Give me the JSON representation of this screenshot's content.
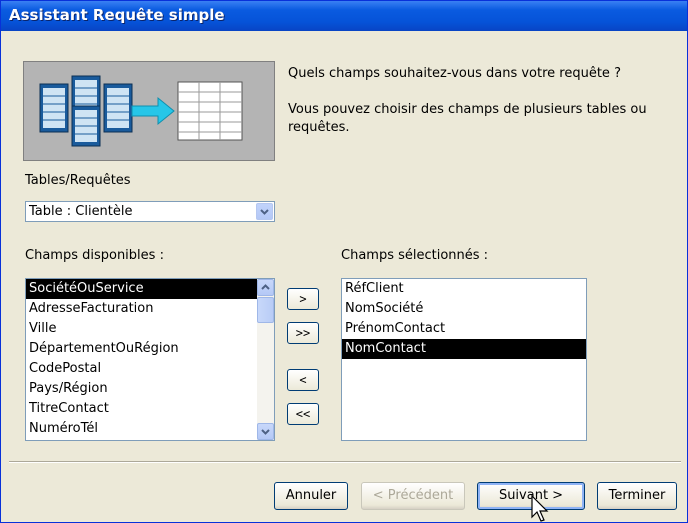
{
  "window": {
    "title": "Assistant Requête simple"
  },
  "prompt": {
    "line1": "Quels champs souhaitez-vous dans votre requête ?",
    "line2": "Vous pouvez choisir des champs de plusieurs tables ou requêtes."
  },
  "tables": {
    "label": "Tables/Requêtes",
    "selected": "Table : Clientèle"
  },
  "available": {
    "label": "Champs disponibles :",
    "items": [
      "SociétéOuService",
      "AdresseFacturation",
      "Ville",
      "DépartementOuRégion",
      "CodePostal",
      "Pays/Région",
      "TitreContact",
      "NuméroTél"
    ]
  },
  "selected": {
    "label": "Champs sélectionnés :",
    "items": [
      "RéfClient",
      "NomSociété",
      "PrénomContact",
      "NomContact"
    ]
  },
  "move_buttons": {
    "add_one": ">",
    "add_all": ">>",
    "remove_one": "<",
    "remove_all": "<<"
  },
  "buttons": {
    "cancel": "Annuler",
    "back": "< Précédent",
    "next": "Suivant >",
    "finish": "Terminer"
  },
  "colors": {
    "titlebar": "#0653d8",
    "selection": "#000000",
    "dialog_bg": "#ece9d8"
  }
}
